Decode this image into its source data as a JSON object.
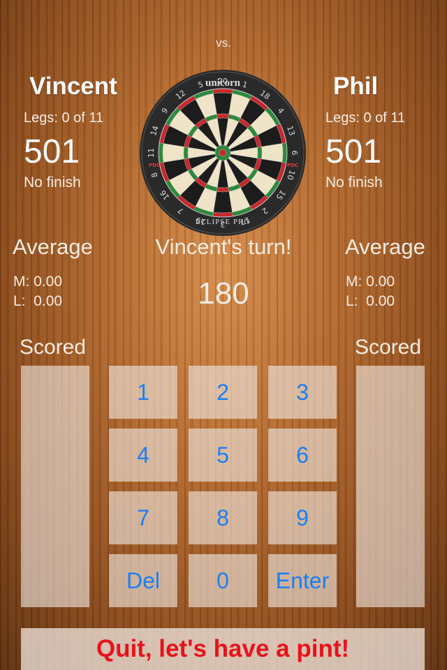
{
  "header": {
    "vs_label": "vs."
  },
  "players": [
    {
      "name": "Vincent",
      "legs_label": "Legs:",
      "legs_value": "0 of 11",
      "score": "501",
      "finish": "No finish",
      "average_title": "Average",
      "avg_m": "M: 0.00",
      "avg_l": "L:  0.00",
      "scored_title": "Scored"
    },
    {
      "name": "Phil",
      "legs_label": "Legs:",
      "legs_value": "0 of 11",
      "score": "501",
      "finish": "No finish",
      "average_title": "Average",
      "avg_m": "M: 0.00",
      "avg_l": "L:  0.00",
      "scored_title": "Scored"
    }
  ],
  "turn_text": "Vincent's turn!",
  "current_input": "180",
  "dartboard": {
    "brand": "unicorn",
    "model": "ECLIPSE PRO",
    "badge": "PDC",
    "numbers": [
      "20",
      "1",
      "18",
      "4",
      "13",
      "6",
      "10",
      "15",
      "2",
      "17",
      "3",
      "19",
      "7",
      "16",
      "8",
      "11",
      "14",
      "9",
      "12",
      "5"
    ]
  },
  "keypad": {
    "k1": "1",
    "k2": "2",
    "k3": "3",
    "k4": "4",
    "k5": "5",
    "k6": "6",
    "k7": "7",
    "k8": "8",
    "k9": "9",
    "del": "Del",
    "k0": "0",
    "enter": "Enter"
  },
  "quit_label": "Quit, let's have a pint!",
  "colors": {
    "key_text": "#1a7ff0",
    "quit_text": "#e8121b",
    "board_red": "#c8282c",
    "board_green": "#2c8a3c"
  }
}
